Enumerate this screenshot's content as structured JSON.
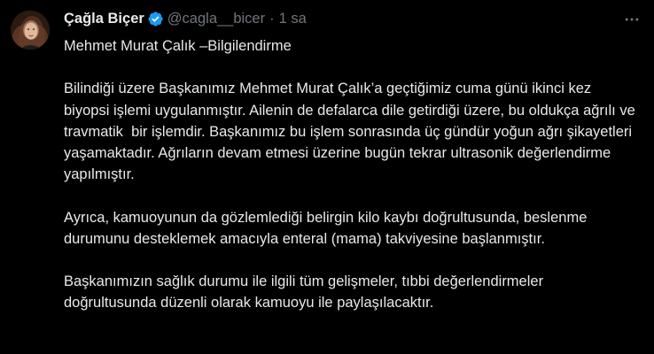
{
  "author": {
    "display_name": "Çağla Biçer",
    "handle": "@cagla__bicer",
    "separator": "·",
    "time": "1 sa",
    "verified": true,
    "verified_color": "#1d9bf0"
  },
  "icons": {
    "avatar": "profile-photo",
    "verified": "verified-badge-icon",
    "more": "more-horizontal-icon"
  },
  "tweet": {
    "title": "Mehmet Murat Çalık –Bilgilendirme",
    "paragraph1": "Bilindiği üzere Başkanımız Mehmet Murat Çalık’a geçtiğimiz cuma günü ikinci kez  biyopsi işlemi uygulanmıştır. Ailenin de defalarca dile getirdiği üzere, bu oldukça ağrılı ve travmatik  bir işlemdir. Başkanımız bu işlem sonrasında üç gündür yoğun ağrı şikayetleri yaşamaktadır. Ağrıların devam etmesi üzerine bugün tekrar ultrasonik değerlendirme yapılmıştır.",
    "paragraph2": "Ayrıca, kamuoyunun da gözlemlediği belirgin kilo kaybı doğrultusunda, beslenme durumunu desteklemek amacıyla enteral (mama) takviyesine başlanmıştır.",
    "paragraph3": "Başkanımızın sağlık durumu ile ilgili tüm gelişmeler, tıbbi değerlendirmeler doğrultusunda düzenli olarak kamuoyu ile paylaşılacaktır."
  },
  "colors": {
    "background": "#000000",
    "text_primary": "#e7e9ea",
    "text_secondary": "#71767b"
  }
}
